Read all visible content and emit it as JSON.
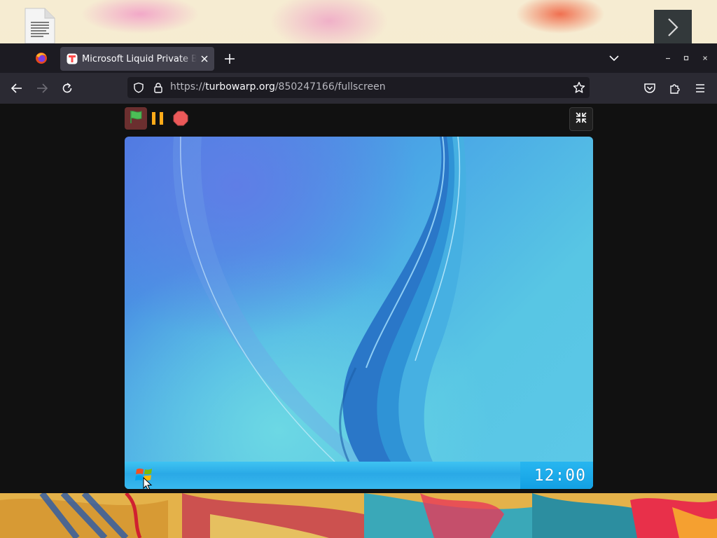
{
  "desktop": {
    "file_icon": "text-file-icon",
    "arrow_icon": "chevron-right-icon"
  },
  "browser": {
    "tab": {
      "title": "Microsoft Liquid Private Beta",
      "favicon": "turbowarp-favicon-icon"
    },
    "url": {
      "prefix": "https://",
      "domain": "turbowarp.org",
      "path": "/850247166/fullscreen"
    },
    "icons": {
      "browser_menu": "firefox-icon",
      "back": "arrow-left-icon",
      "forward": "arrow-right-icon",
      "reload": "reload-icon",
      "shield": "shield-icon",
      "lock": "lock-icon",
      "bookmark": "star-icon",
      "pocket": "pocket-icon",
      "extensions": "puzzle-icon",
      "menu": "hamburger-icon"
    }
  },
  "player": {
    "controls": [
      "green-flag",
      "pause",
      "stop",
      "exit-fullscreen"
    ],
    "colors": {
      "flag": "#4cbf56",
      "pause": "#ffab19",
      "stop": "#ec5959"
    }
  },
  "stage": {
    "clock": "12:00",
    "start_icon": "windows-logo-icon"
  }
}
